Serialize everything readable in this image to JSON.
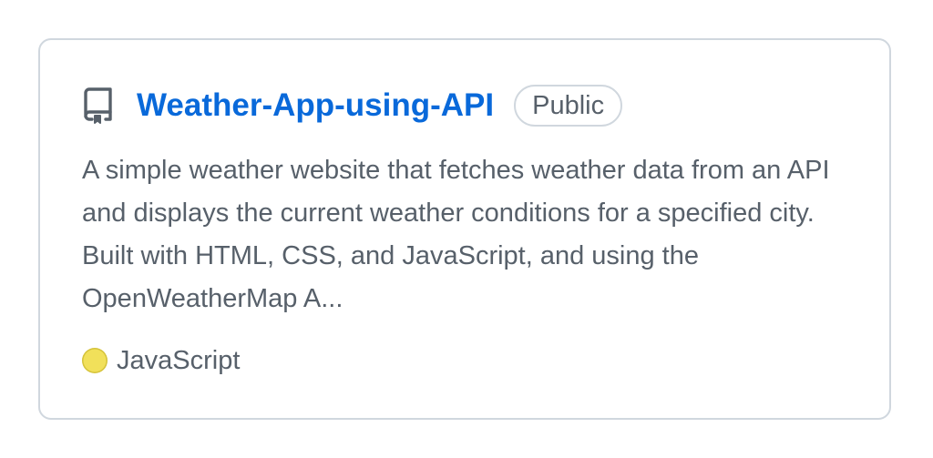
{
  "repo": {
    "icon": "repo-icon",
    "name": "Weather-App-using-API",
    "visibility": "Public",
    "description": "A simple weather website that fetches weather data from an API and displays the current weather conditions for a specified city. Built with HTML, CSS, and JavaScript, and using the OpenWeatherMap A...",
    "language": {
      "name": "JavaScript",
      "color": "#f1e05a"
    }
  },
  "colors": {
    "link": "#0969da",
    "muted_text": "#57606a",
    "border": "#d0d7de"
  }
}
